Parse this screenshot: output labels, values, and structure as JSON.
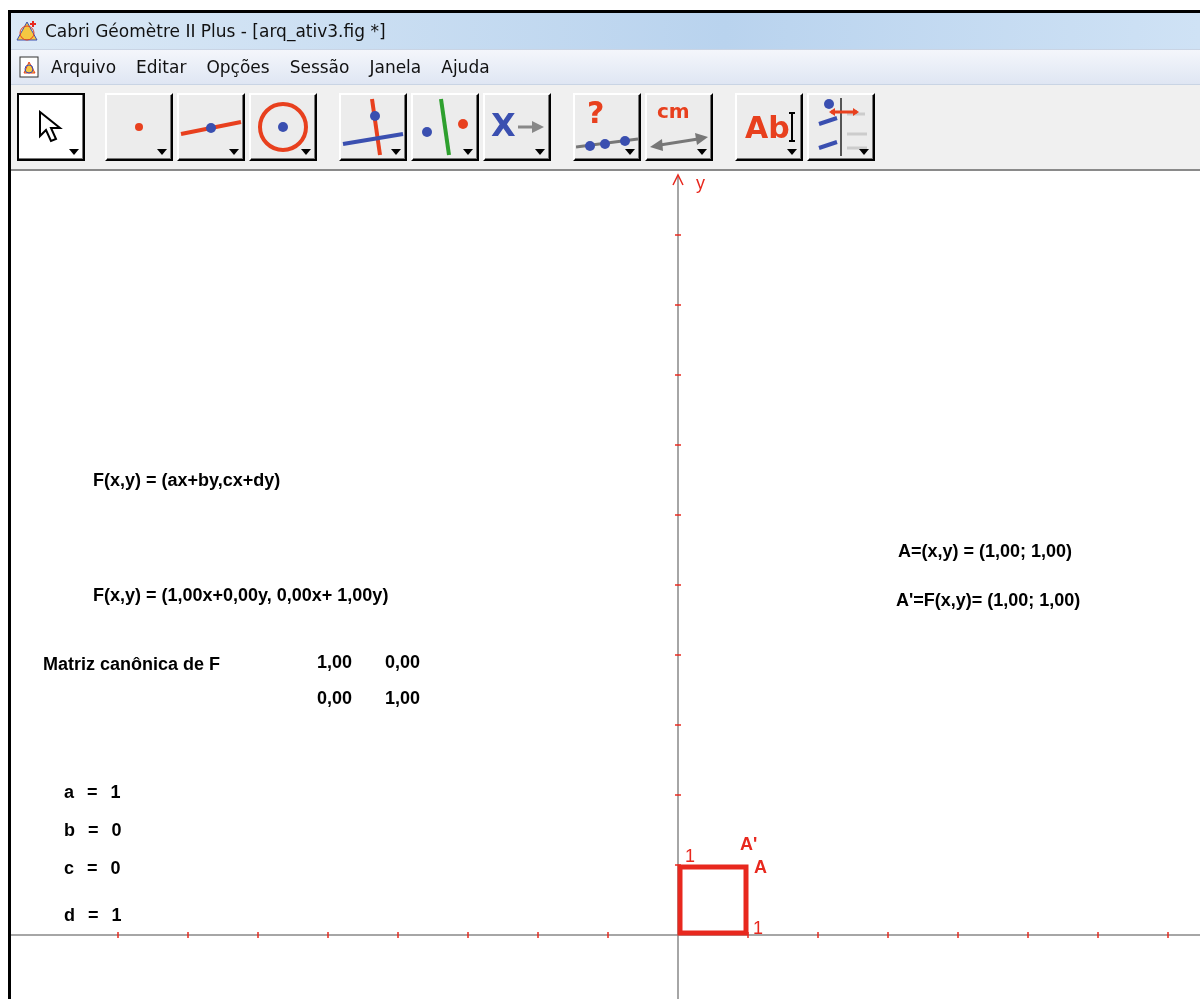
{
  "window": {
    "title": "Cabri Géomètre II Plus - [arq_ativ3.fig *]"
  },
  "menu": [
    "Arquivo",
    "Editar",
    "Opções",
    "Sessão",
    "Janela",
    "Ajuda"
  ],
  "toolbar": [
    {
      "kind": "pointer",
      "selected": true
    },
    {
      "kind": "point",
      "selected": false
    },
    {
      "kind": "line",
      "selected": false
    },
    {
      "kind": "circle",
      "selected": false
    },
    {
      "kind": "perpendicular",
      "selected": false
    },
    {
      "kind": "symmetry",
      "selected": false
    },
    {
      "kind": "transform",
      "glyph": "X",
      "selected": false
    },
    {
      "kind": "check",
      "glyph": "?",
      "selected": false
    },
    {
      "kind": "measure",
      "glyph": "cm",
      "selected": false
    },
    {
      "kind": "text",
      "glyph": "Ab",
      "selected": false
    },
    {
      "kind": "display",
      "selected": false
    }
  ],
  "canvas": {
    "axis_label": "y",
    "formulas": [
      "F(x,y) = (ax+by,cx+dy)",
      "F(x,y) = (1,00x+0,00y, 0,00x+ 1,00y)"
    ],
    "matrix": {
      "label": "Matriz canônica de F",
      "rows": [
        [
          "1,00",
          "0,00"
        ],
        [
          "0,00",
          "1,00"
        ]
      ]
    },
    "parameters": [
      "a = 1",
      "b = 0",
      "c = 0",
      "d = 1"
    ],
    "coordinates": [
      "A=(x,y) = (1,00; 1,00)",
      "A'=F(x,y)= (1,00; 1,00)"
    ],
    "unit_labels": [
      "1",
      "1"
    ],
    "point_labels": [
      "A'",
      "A"
    ]
  }
}
